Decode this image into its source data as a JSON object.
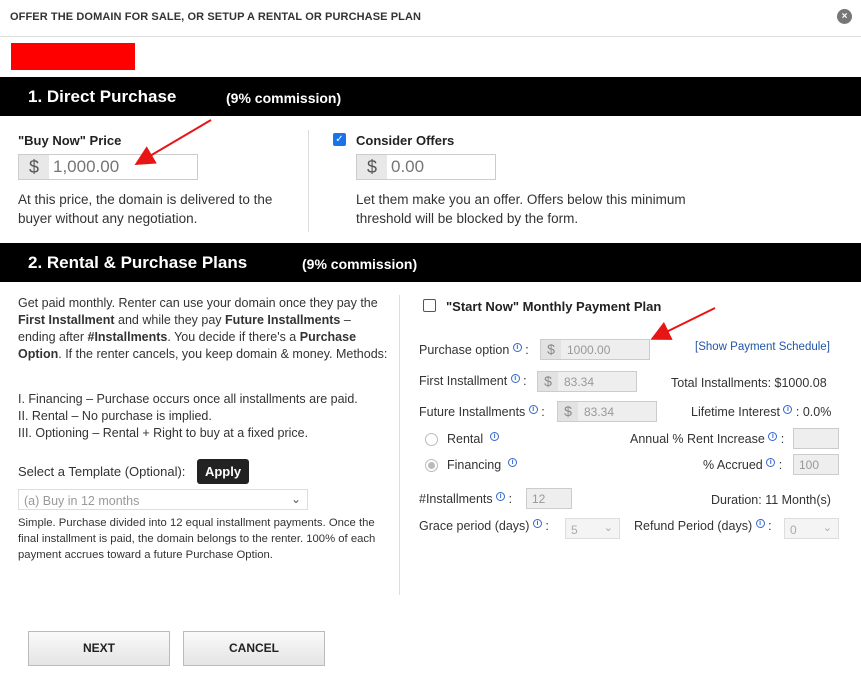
{
  "dialog": {
    "title": "OFFER THE DOMAIN FOR SALE, OR SETUP A RENTAL OR PURCHASE PLAN",
    "close_glyph": "×"
  },
  "section1": {
    "title": "1. Direct Purchase",
    "commission": "(9% commission)",
    "buy_now": {
      "label": "\"Buy Now\" Price",
      "currency": "$",
      "placeholder": "1,000.00",
      "help": "At this price, the domain is delivered to the buyer without any negotiation."
    },
    "offers": {
      "label": "Consider Offers",
      "checked": true,
      "currency": "$",
      "placeholder": "0.00",
      "help": "Let them make you an offer. Offers below this minimum threshold will be blocked by the form."
    }
  },
  "section2": {
    "title": "2. Rental & Purchase Plans",
    "commission": "(9% commission)",
    "description": {
      "p1_a": "Get paid monthly. Renter can use your domain once they pay the ",
      "p1_b": "First Installment",
      "p1_c": " and while they pay ",
      "p1_d": "Future Installments",
      "p1_e": " – ending after ",
      "p1_f": "#Installments",
      "p1_g": ". You decide if there's a ",
      "p1_h": "Purchase Option",
      "p1_i": ". If the renter cancels, you keep domain & money. Methods:",
      "m1": "I. Financing – Purchase occurs once all installments are paid.",
      "m2": "II. Rental – No purchase is implied.",
      "m3": "III. Optioning – Rental + Right to buy at a fixed price."
    },
    "template": {
      "label": "Select a Template (Optional):",
      "apply": "Apply",
      "selected": "(a) Buy in 12 months",
      "note": "Simple. Purchase divided into 12 equal installment payments. Once the final installment is paid, the domain belongs to the renter. 100% of each payment accrues toward a future Purchase Option."
    },
    "plan": {
      "checkbox_label": "\"Start Now\" Monthly Payment Plan",
      "checked": false,
      "show_schedule": "[Show Payment Schedule]",
      "purchase_option": {
        "label": "Purchase option",
        "currency": "$",
        "value": "1000.00"
      },
      "first_installment": {
        "label": "First Installment",
        "currency": "$",
        "value": "83.34"
      },
      "future_installments": {
        "label": "Future Installments",
        "currency": "$",
        "value": "83.34"
      },
      "total_installments": "Total Installments: $1000.08",
      "lifetime_interest_label": "Lifetime Interest",
      "lifetime_interest_value": "0.0%",
      "rental_label": "Rental",
      "financing_label": "Financing",
      "annual_rent_label": "Annual % Rent Increase",
      "annual_rent_value": "",
      "accrued_label": "% Accrued",
      "accrued_value": "100",
      "installments_label": "#Installments",
      "installments_value": "12",
      "duration": "Duration: 11 Month(s)",
      "grace_label": "Grace period (days)",
      "grace_value": "5",
      "refund_label": "Refund Period (days)",
      "refund_value": "0"
    }
  },
  "buttons": {
    "next": "NEXT",
    "cancel": "CANCEL"
  },
  "colors": {
    "section_bar": "#000000",
    "redacted": "#ff0000",
    "annotation_arrow": "#e81515",
    "checkbox_checked": "#1a73e8"
  }
}
